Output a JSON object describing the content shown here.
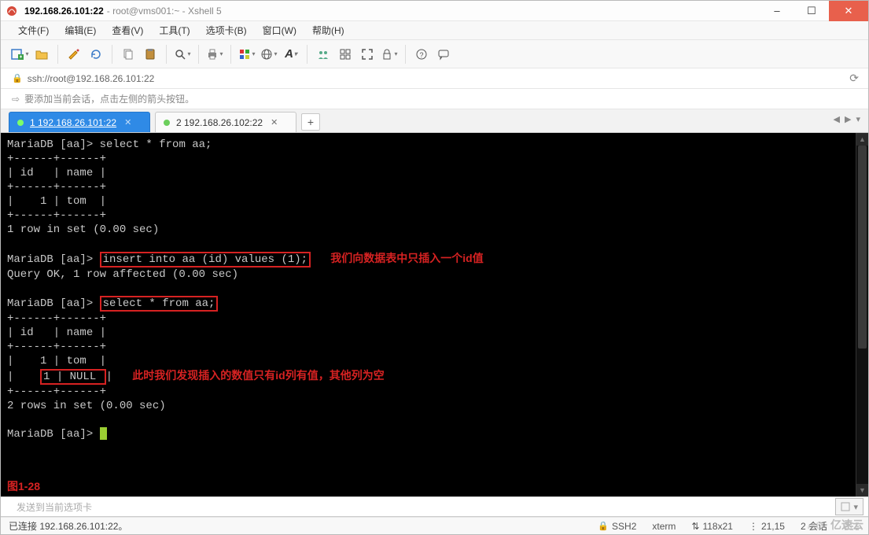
{
  "title": {
    "host": "192.168.26.101:22",
    "rest": "root@vms001:~ - Xshell 5"
  },
  "menu": {
    "file": "文件(F)",
    "edit": "编辑(E)",
    "view": "查看(V)",
    "tools": "工具(T)",
    "tabs": "选项卡(B)",
    "window": "窗口(W)",
    "help": "帮助(H)"
  },
  "address": {
    "url": "ssh://root@192.168.26.101:22"
  },
  "hint": {
    "text": "要添加当前会话，点击左侧的箭头按钮。"
  },
  "tabs": [
    {
      "label": "1 192.168.26.101:22",
      "active": true
    },
    {
      "label": "2 192.168.26.102:22",
      "active": false
    }
  ],
  "terminal": {
    "prompt": "MariaDB [aa]>",
    "lines": {
      "sel1": "select * from aa;",
      "border": "+------+------+",
      "header": "| id   | name |",
      "row_tom": "|    1 | tom  |",
      "rows1": "1 row in set (0.00 sec)",
      "insert_cmd": "insert into aa (id) values (1);",
      "ann1": "我们向数据表中只插入一个id值",
      "query_ok": "Query OK, 1 row affected (0.00 sec)",
      "sel2": "select * from aa;",
      "row_null_prefix": "|    ",
      "row_null_val": "1 | NULL ",
      "row_null_suffix": "|",
      "ann2": "此时我们发现插入的数值只有id列有值，其他列为空",
      "rows2": "2 rows in set (0.00 sec)",
      "figlabel": "图1-28"
    }
  },
  "term_input": {
    "placeholder_suffix": "发送到当前选项卡"
  },
  "status": {
    "connected": "已连接 192.168.26.101:22。",
    "proto": "SSH2",
    "term": "xterm",
    "size": "118x21",
    "cursor": "21,15",
    "sessions": "2 会话"
  },
  "watermark": "亿速云",
  "icons": {
    "new": "new-tab-icon",
    "open": "open-folder-icon",
    "props": "properties-icon",
    "copy": "copy-icon",
    "paste": "paste-icon",
    "search": "search-icon",
    "print": "print-icon",
    "color": "color-scheme-icon",
    "globe": "globe-icon",
    "font": "font-icon",
    "users": "users-icon",
    "fullscreen": "fullscreen-icon",
    "transfer": "transfer-icon",
    "lock": "lock-icon",
    "help": "help-icon",
    "feedback": "feedback-icon"
  },
  "win_buttons": {
    "min": "–",
    "max": "☐",
    "close": "✕"
  }
}
